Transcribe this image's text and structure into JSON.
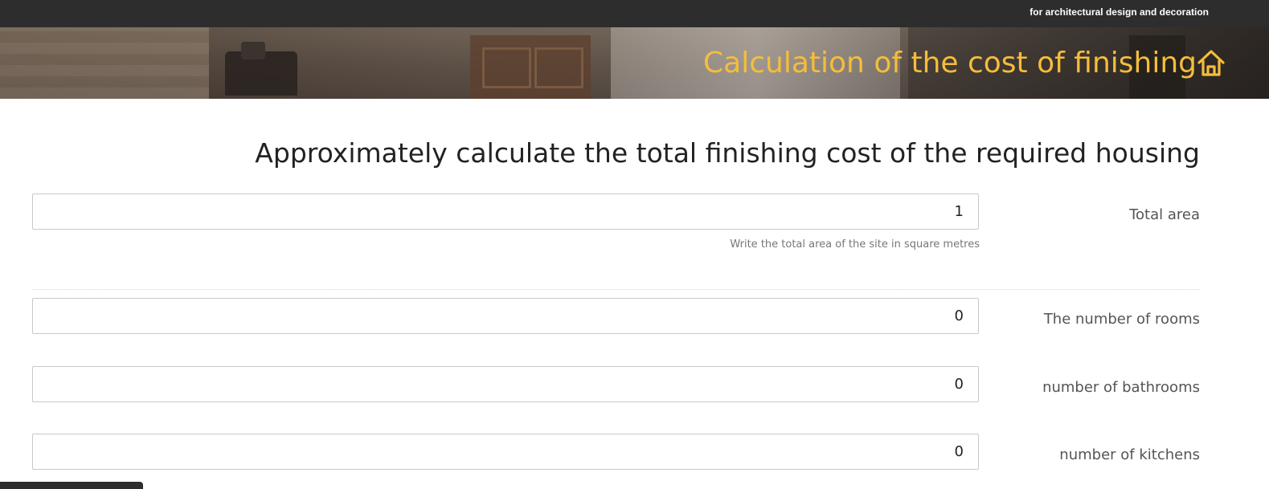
{
  "topbar": {
    "tagline": "for architectural design and decoration"
  },
  "hero": {
    "title": "Calculation of the cost of finishing",
    "icon": "home-icon",
    "title_color": "#f5bd3a"
  },
  "form": {
    "heading": "Approximately calculate the total finishing cost of the required housing",
    "fields": [
      {
        "label": "Total area",
        "value": "1",
        "help": "Write the total area of the site in square metres"
      },
      {
        "label": "The number of rooms",
        "value": "0"
      },
      {
        "label": "number of bathrooms",
        "value": "0"
      },
      {
        "label": "number of kitchens",
        "value": "0"
      }
    ]
  }
}
